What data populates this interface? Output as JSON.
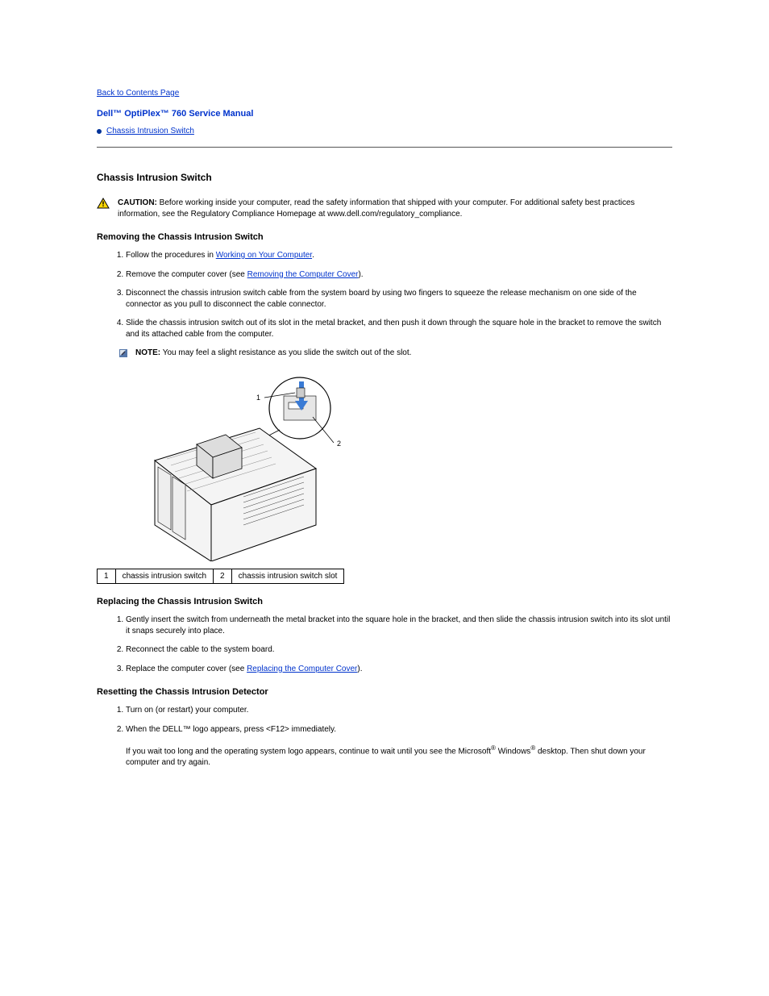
{
  "toc_link": "Back to Contents Page",
  "manual_title": "Dell™ OptiPlex™ 760 Service Manual",
  "bullets": {
    "item0": "Chassis Intrusion Switch"
  },
  "section_title": "Chassis Intrusion Switch",
  "caution1": {
    "label": "CAUTION:",
    "body": "Before working inside your computer, read the safety information that shipped with your computer. For additional safety best practices information, see the Regulatory Compliance Homepage at www.dell.com/regulatory_compliance."
  },
  "sub_remove": "Removing the Chassis Intrusion Switch",
  "remove_steps": {
    "s1_a": "Follow the procedures in ",
    "s1_link": "Working on Your Computer",
    "s1_b": ".",
    "s2_a": "Remove the computer cover (see ",
    "s2_link": "Removing the Computer Cover",
    "s2_b": ").",
    "s3": "Disconnect the chassis intrusion switch cable from the system board by using two fingers to squeeze the release mechanism on one side of the connector as you pull to disconnect the cable connector.",
    "s4": "Slide the chassis intrusion switch out of its slot in the metal bracket, and then push it down through the square hole in the bracket to remove the switch and its attached cable from the computer."
  },
  "note1": {
    "label": "NOTE:",
    "body": "You may feel a slight resistance as you slide the switch out of the slot."
  },
  "callouts": {
    "r1n": "1",
    "r1t": "chassis intrusion switch",
    "r2n": "2",
    "r2t": "chassis intrusion switch slot"
  },
  "sub_replace": "Replacing the Chassis Intrusion Switch",
  "replace_steps": {
    "s1": "Gently insert the switch from underneath the metal bracket into the square hole in the bracket, and then slide the chassis intrusion switch into its slot until it snaps securely into place.",
    "s2": "Reconnect the cable to the system board.",
    "s3_a": "Replace the computer cover (see ",
    "s3_link": "Replacing the Computer Cover",
    "s3_b": ")."
  },
  "sub_reset": "Resetting the Chassis Intrusion Detector",
  "reset_steps": {
    "s1": "Turn on (or restart) your computer.",
    "s2_main": "When the DELL™ logo appears, press <F12> immediately.",
    "s2_para_a": "If you wait too long and the operating system logo appears, continue to wait until you see the Microsoft",
    "s2_para_b": " Windows",
    "s2_para_c": " desktop. Then shut down your computer and try again.",
    "r": "®"
  }
}
